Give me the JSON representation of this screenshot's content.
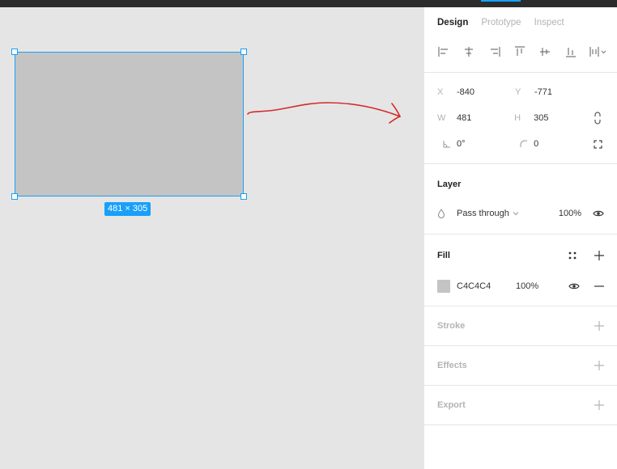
{
  "canvas": {
    "size_badge": "481 × 305"
  },
  "panel": {
    "tabs": [
      "Design",
      "Prototype",
      "Inspect"
    ],
    "position": {
      "x_label": "X",
      "x_value": "-840",
      "y_label": "Y",
      "y_value": "-771",
      "w_label": "W",
      "w_value": "481",
      "h_label": "H",
      "h_value": "305",
      "rotation_value": "0°",
      "radius_value": "0"
    },
    "layer": {
      "title": "Layer",
      "blend_mode": "Pass through",
      "opacity": "100%"
    },
    "fill": {
      "title": "Fill",
      "color_hex": "C4C4C4",
      "opacity": "100%",
      "swatch_color": "#c4c4c4"
    },
    "stroke": {
      "title": "Stroke"
    },
    "effects": {
      "title": "Effects"
    },
    "export": {
      "title": "Export"
    }
  },
  "colors": {
    "selection": "#18a0fb",
    "annotation_arrow": "#d42a2a"
  }
}
